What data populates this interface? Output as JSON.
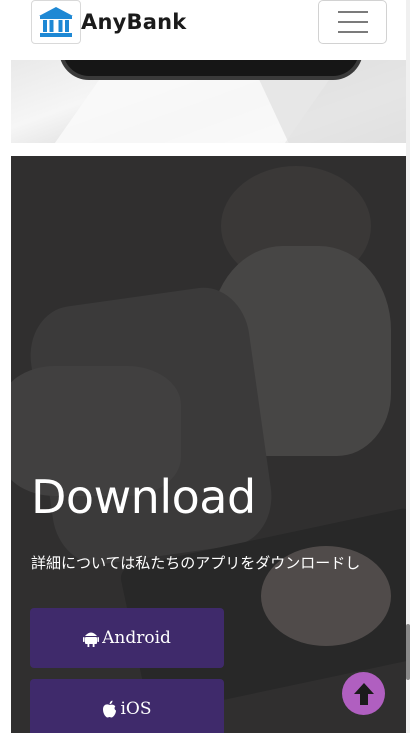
{
  "header": {
    "brand_name": "AnyBank",
    "logo_icon": "bank-icon",
    "menu_icon": "hamburger-menu-icon"
  },
  "hero": {
    "image": "phone-mockup"
  },
  "download": {
    "title": "Download",
    "text": "詳細については私たちのアプリをダウンロードし",
    "android_label": "Android",
    "android_icon": "android-icon",
    "ios_label": "iOS",
    "ios_icon": "apple-icon"
  },
  "back_to_top_icon": "arrow-up-icon",
  "colors": {
    "accent_purple": "#3f2a6b",
    "back_to_top": "#b05fc0",
    "logo_blue": "#1e88d4"
  }
}
